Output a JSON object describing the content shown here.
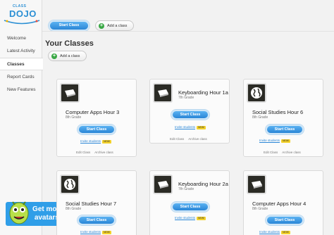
{
  "logo": {
    "top": "CLASS",
    "main": "DOJO"
  },
  "sidebar": {
    "items": [
      {
        "label": "Welcome"
      },
      {
        "label": "Latest Activity"
      },
      {
        "label": "Classes"
      },
      {
        "label": "Report Cards"
      },
      {
        "label": "New Features"
      }
    ],
    "promo": {
      "line1": "Get more",
      "line2": "avatars!"
    }
  },
  "toolbar": {
    "start_label": "Start Class",
    "add_label": "Add a class"
  },
  "main": {
    "title": "Your Classes",
    "add_label": "Add a class",
    "invite_label": "Invite students",
    "new_badge": "NEW!",
    "edit_label": "Edit Class",
    "archive_label": "Archive class",
    "start_label": "Start Class",
    "classes": [
      {
        "name": "Computer Apps Hour 3",
        "grade": "8th Grade",
        "icon": "laptop-icon"
      },
      {
        "name": "Keyboarding Hour 1a",
        "grade": "7th Grade",
        "icon": "laptop-icon"
      },
      {
        "name": "Social Studies Hour 6",
        "grade": "8th Grade",
        "icon": "globe-icon"
      },
      {
        "name": "Social Studies Hour 7",
        "grade": "8th Grade",
        "icon": "globe-icon"
      },
      {
        "name": "Keyboarding Hour 2a",
        "grade": "7th Grade",
        "icon": "laptop-icon"
      },
      {
        "name": "Computer Apps Hour 4",
        "grade": "8th Grade",
        "icon": "laptop-icon"
      }
    ]
  },
  "colors": {
    "accent": "#2a86d6",
    "new_badge": "#f4d22a",
    "add_green": "#3aa845",
    "promo": "#2f9ee8"
  }
}
